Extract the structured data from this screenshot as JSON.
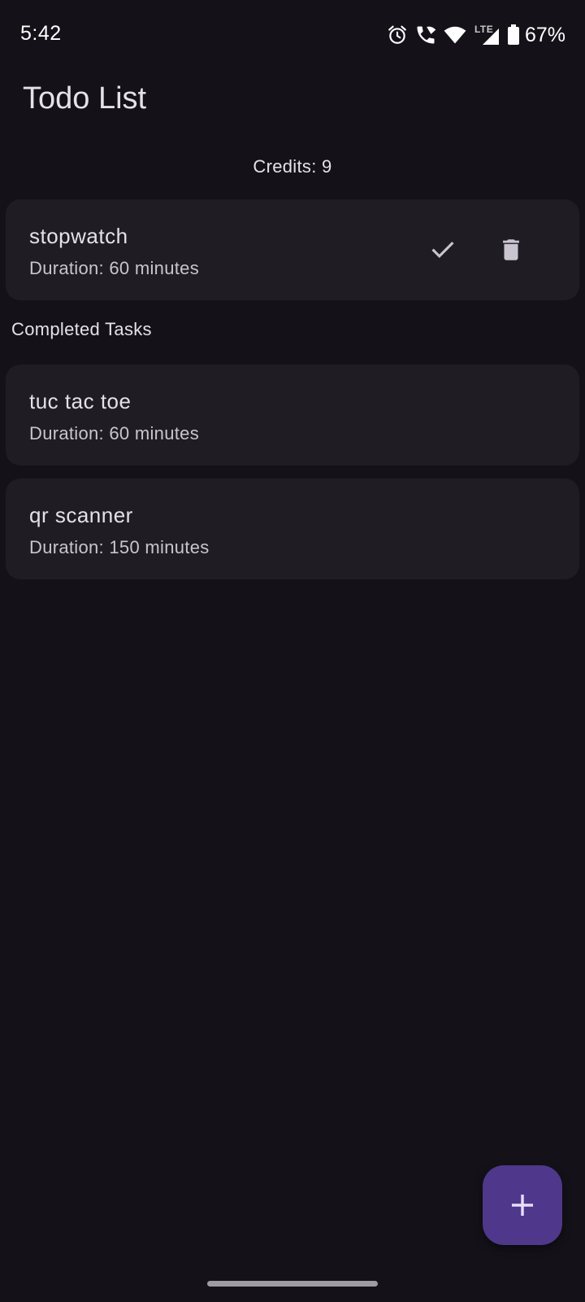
{
  "status_bar": {
    "time": "5:42",
    "network_label": "LTE",
    "battery_percent": "67%"
  },
  "app_bar": {
    "title": "Todo List"
  },
  "credits_text": "Credits: 9",
  "pending_tasks": [
    {
      "name": "stopwatch",
      "duration": "Duration: 60 minutes"
    }
  ],
  "completed_section": {
    "title": "Completed Tasks",
    "tasks": [
      {
        "name": "tuc tac toe",
        "duration": "Duration: 60 minutes"
      },
      {
        "name": "qr scanner",
        "duration": "Duration: 150 minutes"
      }
    ]
  },
  "fab": {
    "icon": "plus-icon"
  },
  "colors": {
    "background": "#141218",
    "card": "#1f1d23",
    "fab": "#4f378b",
    "text_primary": "#e6e0e9",
    "text_secondary": "#cac4d0"
  }
}
